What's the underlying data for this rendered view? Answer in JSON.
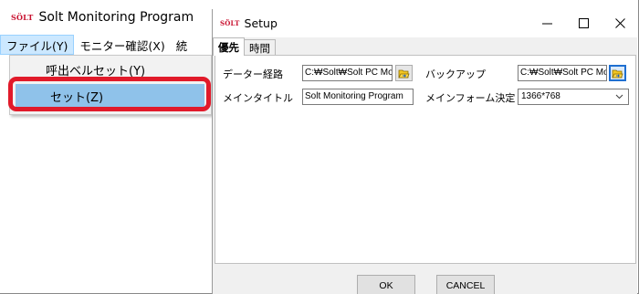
{
  "main_window": {
    "logo_text": "SÖLT",
    "title": "Solt Monitoring Program",
    "menu": [
      {
        "label": "ファイル(Y)"
      },
      {
        "label": "モニター確認(X)"
      },
      {
        "label": "統"
      }
    ],
    "dropdown": [
      {
        "label": "呼出ベルセット(Y)"
      },
      {
        "label": "セット(Z)"
      }
    ]
  },
  "dialog": {
    "logo_text": "SÖLT",
    "title": "Setup",
    "controls": {
      "minimize": "—",
      "maximize": "☐",
      "close": "✕"
    },
    "tabs": [
      {
        "label": "優先",
        "selected": true
      },
      {
        "label": "時間",
        "selected": false
      }
    ],
    "data_path": {
      "label": "データー経路",
      "value": "C:₩Solt₩Solt PC Mon"
    },
    "backup": {
      "label": "バックアップ",
      "value": "C:₩Solt₩Solt PC Mo"
    },
    "main_title": {
      "label": "メインタイトル",
      "value": "Solt Monitoring Program"
    },
    "main_form": {
      "label": "メインフォーム決定",
      "value": "1366*768"
    },
    "buttons": {
      "ok": "OK",
      "cancel": "CANCEL"
    }
  },
  "colors": {
    "highlight_border": "#e11a2a",
    "selected_menu_item": "#8fc2ea",
    "logo": "#c8102e"
  }
}
